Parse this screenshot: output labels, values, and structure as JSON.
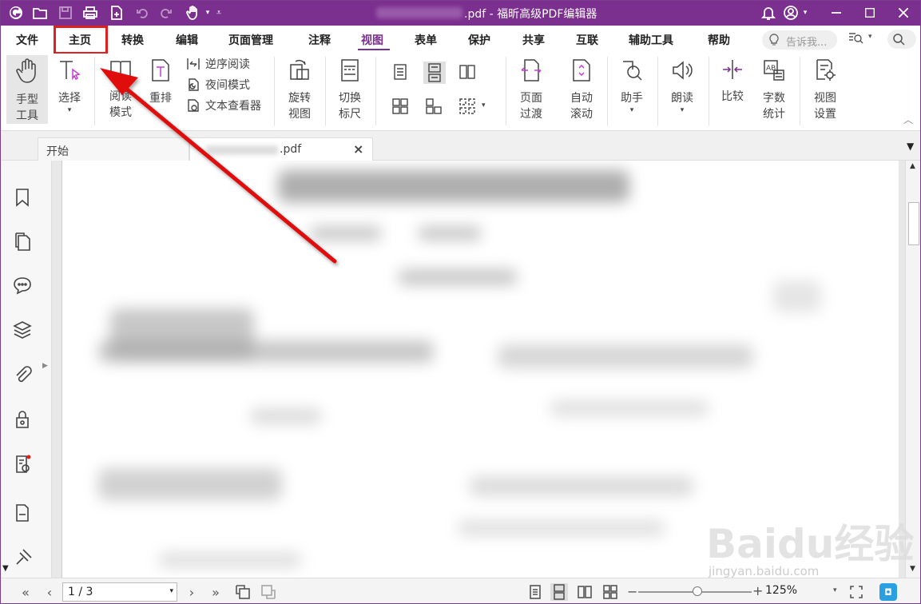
{
  "window": {
    "title_suffix": ".pdf - 福昕高级PDF编辑器"
  },
  "menu": {
    "items": [
      "文件",
      "主页",
      "转换",
      "编辑",
      "页面管理",
      "注释",
      "视图",
      "表单",
      "保护",
      "共享",
      "互联",
      "辅助工具",
      "帮助"
    ],
    "active": "视图",
    "highlighted": "主页",
    "tell_me_placeholder": "告诉我..."
  },
  "ribbon": {
    "hand_tool": [
      "手型",
      "工具"
    ],
    "select": "选择",
    "read_mode": [
      "阅读",
      "模式"
    ],
    "reflow": "重排",
    "reverse_read": "逆序阅读",
    "night_mode": "夜间模式",
    "text_viewer": "文本查看器",
    "rotate_view": [
      "旋转",
      "视图"
    ],
    "toggle_ruler": [
      "切换",
      "标尺"
    ],
    "page_transition": [
      "页面",
      "过渡"
    ],
    "auto_scroll": [
      "自动",
      "滚动"
    ],
    "assistant": "助手",
    "read_aloud": "朗读",
    "compare": "比较",
    "word_count": [
      "字数",
      "统计"
    ],
    "view_settings": [
      "视图",
      "设置"
    ]
  },
  "tabs": {
    "start": "开始",
    "doc_suffix": ".pdf"
  },
  "status": {
    "page": "1 / 3",
    "zoom": "125%"
  },
  "watermark": {
    "text": "Baidu经验",
    "url": "jingyan.baidu.com"
  },
  "colors": {
    "brand": "#7b2f8e",
    "highlight": "#e02020"
  }
}
